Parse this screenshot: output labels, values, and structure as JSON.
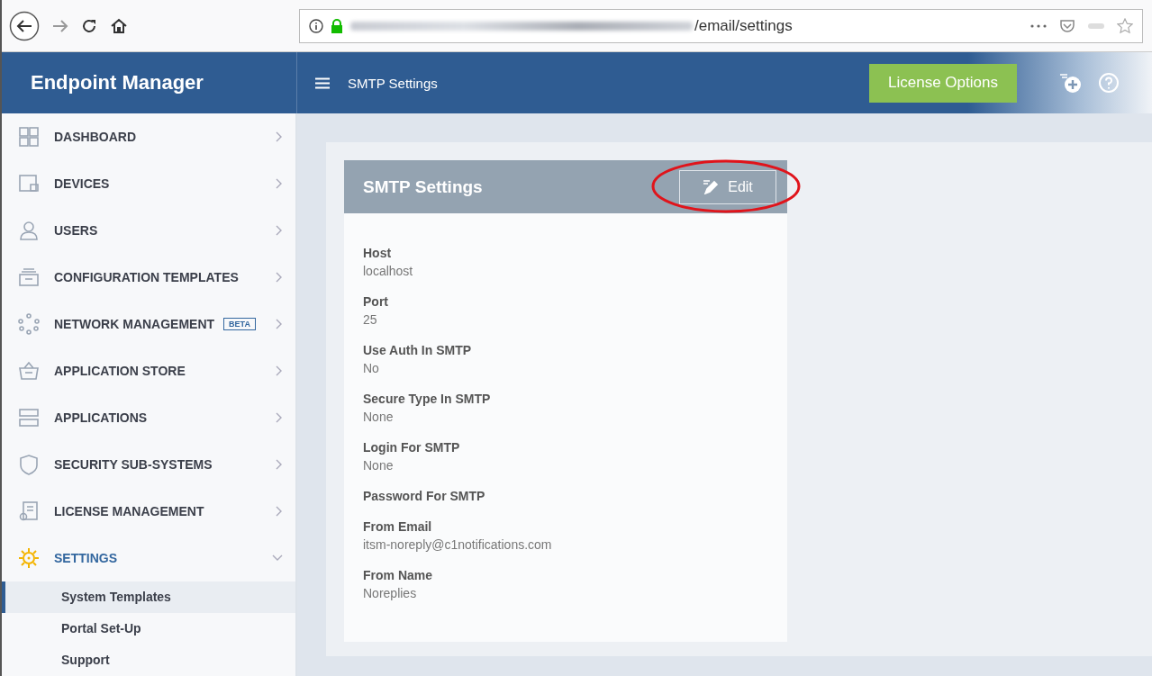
{
  "browser": {
    "url_path": "/email/settings"
  },
  "header": {
    "app_title": "Endpoint Manager",
    "page_title": "SMTP Settings",
    "license_button": "License Options"
  },
  "sidebar": {
    "items": [
      {
        "label": "DASHBOARD",
        "selected": false,
        "expanded": false
      },
      {
        "label": "DEVICES",
        "selected": false,
        "expanded": false
      },
      {
        "label": "USERS",
        "selected": false,
        "expanded": false
      },
      {
        "label": "CONFIGURATION TEMPLATES",
        "selected": false,
        "expanded": false
      },
      {
        "label": "NETWORK MANAGEMENT",
        "badge": "BETA",
        "selected": false,
        "expanded": false
      },
      {
        "label": "APPLICATION STORE",
        "selected": false,
        "expanded": false
      },
      {
        "label": "APPLICATIONS",
        "selected": false,
        "expanded": false
      },
      {
        "label": "SECURITY SUB-SYSTEMS",
        "selected": false,
        "expanded": false
      },
      {
        "label": "LICENSE MANAGEMENT",
        "selected": false,
        "expanded": false
      },
      {
        "label": "SETTINGS",
        "selected": true,
        "expanded": true,
        "children": [
          {
            "label": "System Templates",
            "selected": true
          },
          {
            "label": "Portal Set-Up",
            "selected": false
          },
          {
            "label": "Support",
            "selected": false
          }
        ]
      }
    ]
  },
  "card": {
    "title": "SMTP Settings",
    "edit_button": "Edit",
    "fields": [
      {
        "label": "Host",
        "value": "localhost"
      },
      {
        "label": "Port",
        "value": "25"
      },
      {
        "label": "Use Auth In SMTP",
        "value": "No"
      },
      {
        "label": "Secure Type In SMTP",
        "value": "None"
      },
      {
        "label": "Login For SMTP",
        "value": "None"
      },
      {
        "label": "Password For SMTP"
      },
      {
        "label": "From Email",
        "value": "itsm-noreply@c1notifications.com"
      },
      {
        "label": "From Name",
        "value": "Noreplies"
      }
    ]
  }
}
